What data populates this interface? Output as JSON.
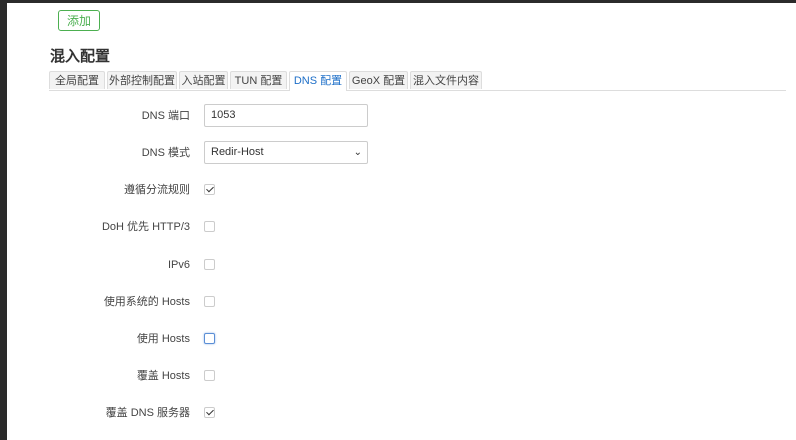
{
  "toolbar": {
    "add_label": "添加"
  },
  "section": {
    "title": "混入配置"
  },
  "tabs": [
    {
      "label": "全局配置",
      "active": false
    },
    {
      "label": "外部控制配置",
      "active": false
    },
    {
      "label": "入站配置",
      "active": false
    },
    {
      "label": "TUN 配置",
      "active": false
    },
    {
      "label": "DNS 配置",
      "active": true
    },
    {
      "label": "GeoX 配置",
      "active": false
    },
    {
      "label": "混入文件内容",
      "active": false
    }
  ],
  "form": {
    "dns_port": {
      "label": "DNS 端口",
      "value": "1053"
    },
    "dns_mode": {
      "label": "DNS 模式",
      "value": "Redir-Host"
    },
    "follow_rules": {
      "label": "遵循分流规则",
      "checked": true
    },
    "doh_http3": {
      "label": "DoH 优先 HTTP/3",
      "checked": false
    },
    "ipv6": {
      "label": "IPv6",
      "checked": false
    },
    "system_hosts": {
      "label": "使用系统的 Hosts",
      "checked": false
    },
    "use_hosts": {
      "label": "使用 Hosts",
      "checked": false
    },
    "override_hosts": {
      "label": "覆盖 Hosts",
      "checked": false
    },
    "override_dns": {
      "label": "覆盖 DNS 服务器",
      "checked": true
    }
  }
}
